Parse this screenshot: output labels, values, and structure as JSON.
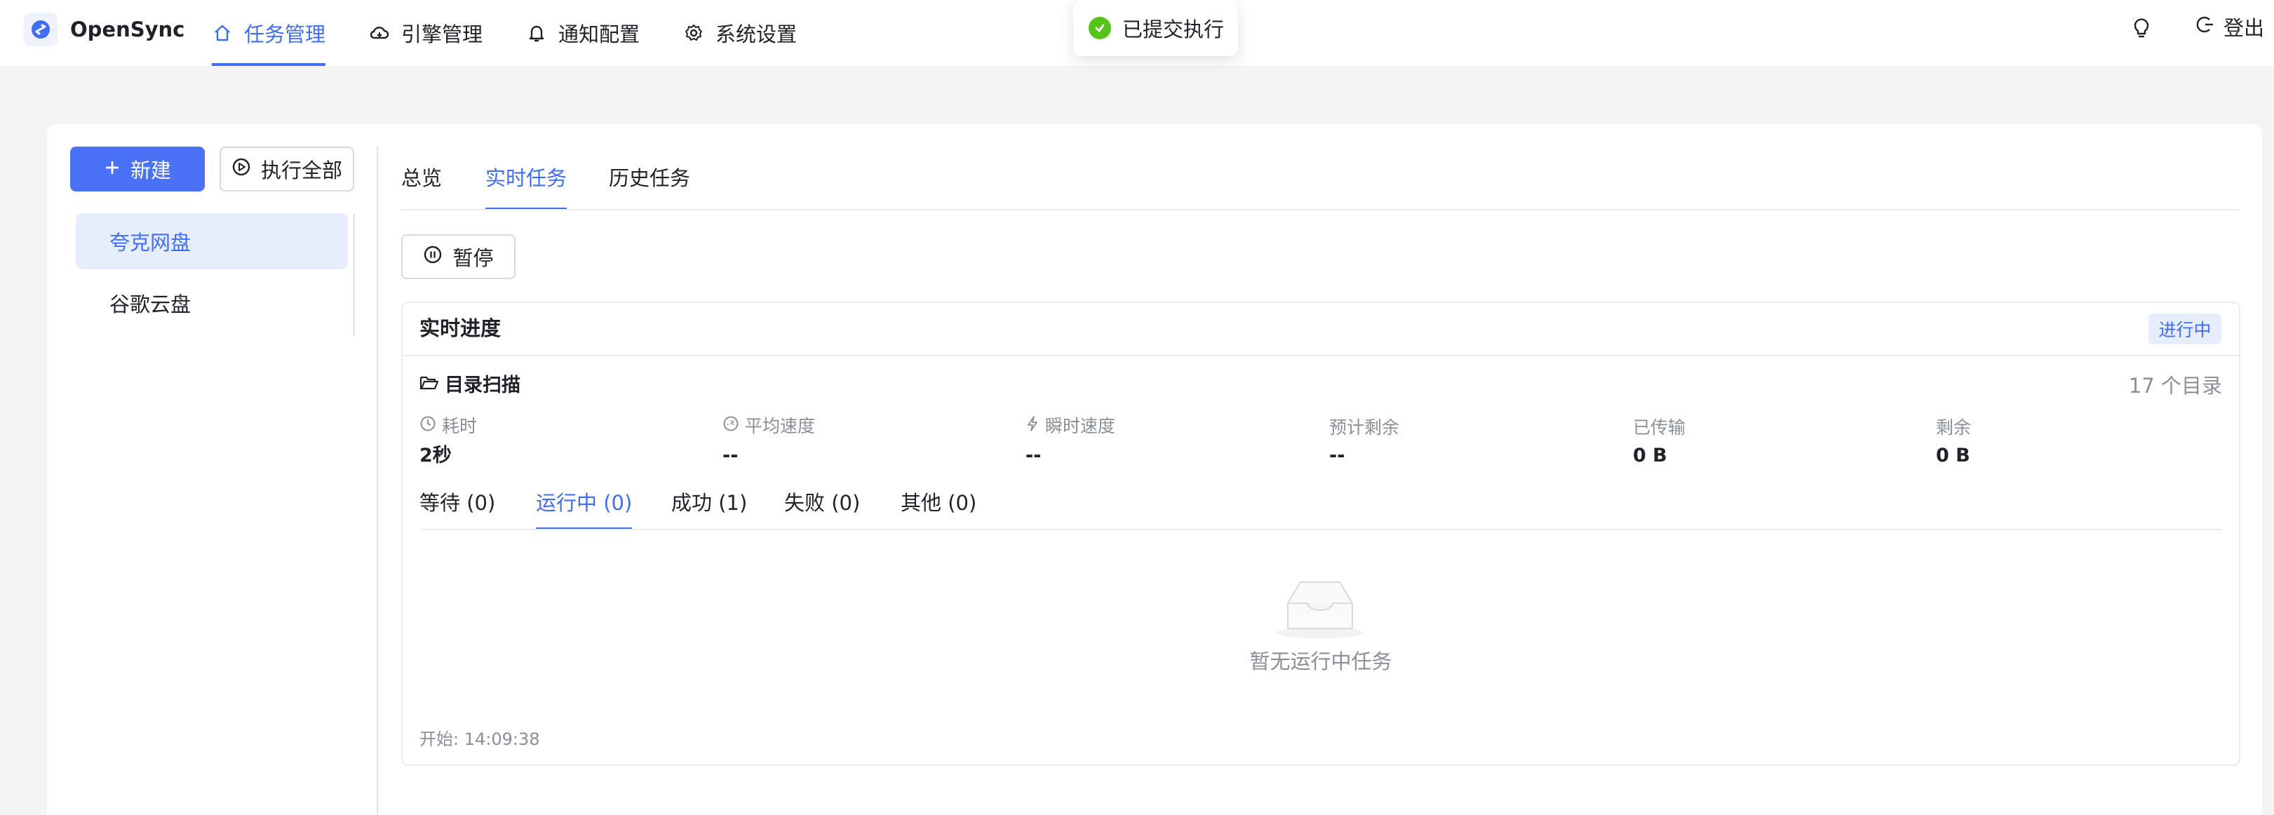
{
  "app": {
    "brand": "OpenSync"
  },
  "nav": {
    "items": [
      {
        "label": "任务管理",
        "icon": "home-icon",
        "active": true
      },
      {
        "label": "引擎管理",
        "icon": "cloud-icon",
        "active": false
      },
      {
        "label": "通知配置",
        "icon": "bell-icon",
        "active": false
      },
      {
        "label": "系统设置",
        "icon": "gear-icon",
        "active": false
      }
    ],
    "logout_label": "登出"
  },
  "toast": {
    "text": "已提交执行",
    "icon": "check-circle-icon"
  },
  "sidebar": {
    "new_label": "新建",
    "run_all_label": "执行全部",
    "items": [
      {
        "label": "夸克网盘",
        "active": true
      },
      {
        "label": "谷歌云盘",
        "active": false
      }
    ]
  },
  "tabs": [
    {
      "label": "总览",
      "active": false
    },
    {
      "label": "实时任务",
      "active": true
    },
    {
      "label": "历史任务",
      "active": false
    }
  ],
  "pause_label": "暂停",
  "progress": {
    "title": "实时进度",
    "status_badge": "进行中",
    "scan_title": "目录扫描",
    "dir_count": "17 个目录",
    "stats": [
      {
        "label": "耗时",
        "value": "2秒",
        "icon": "clock-icon"
      },
      {
        "label": "平均速度",
        "value": "--",
        "icon": "gauge-icon"
      },
      {
        "label": "瞬时速度",
        "value": "--",
        "icon": "lightning-icon"
      },
      {
        "label": "预计剩余",
        "value": "--"
      },
      {
        "label": "已传输",
        "value": "0 B"
      },
      {
        "label": "剩余",
        "value": "0 B"
      }
    ],
    "subtabs": [
      {
        "label": "等待 (0)",
        "active": false
      },
      {
        "label": "运行中 (0)",
        "active": true
      },
      {
        "label": "成功 (1)",
        "active": false
      },
      {
        "label": "失败 (0)",
        "active": false
      },
      {
        "label": "其他 (0)",
        "active": false
      }
    ],
    "empty_text": "暂无运行中任务",
    "start_time": "开始: 14:09:38"
  },
  "colors": {
    "accent": "#3f6df5",
    "primary_button": "#4a71f6",
    "success": "#52c41a",
    "muted_text": "#8a8f99"
  }
}
